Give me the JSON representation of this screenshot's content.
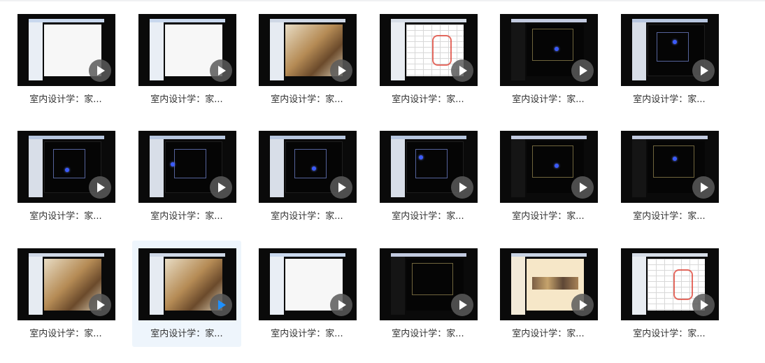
{
  "tiles": [
    {
      "label": "室内设计学：家...",
      "screen": "doc",
      "dot": false,
      "selected": false
    },
    {
      "label": "室内设计学：家...",
      "screen": "doc",
      "dot": false,
      "selected": false
    },
    {
      "label": "室内设计学：家...",
      "screen": "photo",
      "dot": false,
      "selected": false
    },
    {
      "label": "室内设计学：家...",
      "screen": "sheet",
      "dot": false,
      "selected": false
    },
    {
      "label": "室内设计学：家...",
      "screen": "cad2",
      "dot": true,
      "selected": false
    },
    {
      "label": "室内设计学：家...",
      "screen": "cad",
      "dot": true,
      "selected": false
    },
    {
      "label": "室内设计学：家...",
      "screen": "cad",
      "dot": true,
      "selected": false
    },
    {
      "label": "室内设计学：家...",
      "screen": "cad",
      "dot": true,
      "selected": false
    },
    {
      "label": "室内设计学：家...",
      "screen": "cad",
      "dot": true,
      "selected": false
    },
    {
      "label": "室内设计学：家...",
      "screen": "cad",
      "dot": true,
      "selected": false
    },
    {
      "label": "室内设计学：家...",
      "screen": "cad2",
      "dot": true,
      "selected": false
    },
    {
      "label": "室内设计学：家...",
      "screen": "cad2",
      "dot": true,
      "selected": false
    },
    {
      "label": "室内设计学：家...",
      "screen": "photo",
      "dot": false,
      "selected": false
    },
    {
      "label": "室内设计学：家...",
      "screen": "photo",
      "dot": false,
      "selected": true
    },
    {
      "label": "室内设计学：家...",
      "screen": "doc",
      "dot": false,
      "selected": false
    },
    {
      "label": "室内设计学：家...",
      "screen": "cad2",
      "dot": false,
      "selected": false
    },
    {
      "label": "室内设计学：家...",
      "screen": "beige",
      "dot": false,
      "selected": false
    },
    {
      "label": "室内设计学：家...",
      "screen": "sheet",
      "dot": false,
      "selected": false
    }
  ],
  "icons": {
    "play": "play-icon"
  },
  "colors": {
    "selected_bg": "#eef5fc",
    "active_play": "#1e90ff",
    "thumb_bg": "#0a0a0a"
  }
}
